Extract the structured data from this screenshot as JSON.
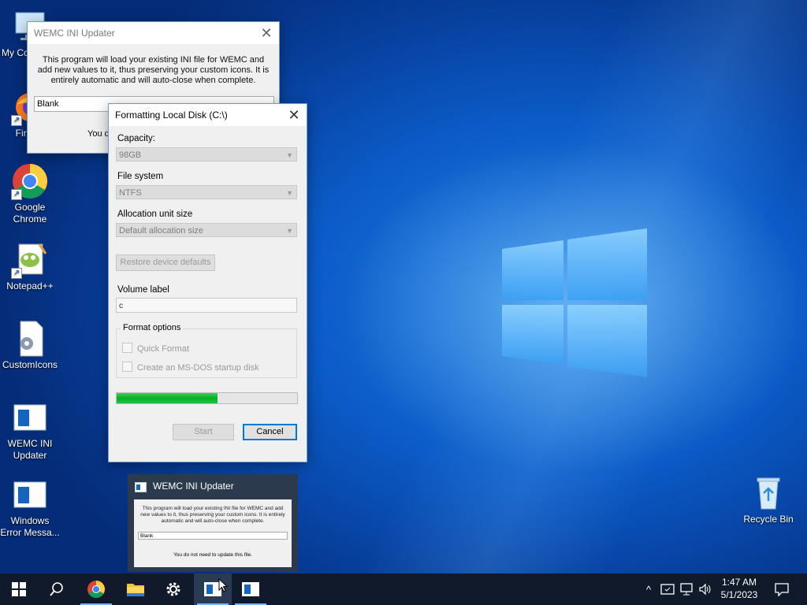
{
  "desktop_icons": [
    {
      "label": "My Computer",
      "icon": "computer-icon"
    },
    {
      "label": "Firefox",
      "icon": "firefox-icon"
    },
    {
      "label": "Google Chrome",
      "icon": "chrome-icon"
    },
    {
      "label": "Notepad++",
      "icon": "notepadpp-icon"
    },
    {
      "label": "CustomIcons",
      "icon": "settings-file-icon"
    },
    {
      "label": "WEMC INI Updater",
      "icon": "app-window-icon"
    },
    {
      "label": "Windows Error Messa...",
      "icon": "app-window-icon"
    },
    {
      "label": "Recycle Bin",
      "icon": "recycle-bin-icon"
    }
  ],
  "wemc_window": {
    "title": "WEMC INI Updater",
    "message": "This program will load your existing INI file for WEMC and add new values to it, thus preserving your custom icons. It is entirely automatic and will auto-close when complete.",
    "select_value": "Blank",
    "note_visible": "You d"
  },
  "format_dialog": {
    "title": "Formatting Local Disk (C:\\)",
    "capacity_label": "Capacity:",
    "capacity_value": "98GB",
    "filesystem_label": "File system",
    "filesystem_value": "NTFS",
    "allocation_label": "Allocation unit size",
    "allocation_value": "Default allocation size",
    "restore_label": "Restore device defaults",
    "volume_label_label": "Volume label",
    "volume_label_value": "c",
    "format_options_label": "Format options",
    "quick_format_label": "Quick Format",
    "msdos_label": "Create an MS-DOS startup disk",
    "progress_percent": 56,
    "start_label": "Start",
    "cancel_label": "Cancel"
  },
  "thumbnail": {
    "title": "WEMC INI Updater",
    "message": "This program will load your existing INI file for WEMC and add new values to it, thus preserving your custom icons. It is entirely automatic and will auto-close when complete.",
    "select_value": "Blank",
    "note": "You do not need to update this file."
  },
  "taskbar": {
    "items": [
      "start-icon",
      "search-icon",
      "chrome-icon",
      "file-explorer-icon",
      "settings-icon",
      "wemc-app-icon",
      "error-app-icon"
    ],
    "clock_time": "1:47 AM",
    "clock_date": "5/1/2023"
  },
  "colors": {
    "accent": "#0078d7",
    "progress": "#06b025",
    "taskbar": "#101a2a"
  }
}
